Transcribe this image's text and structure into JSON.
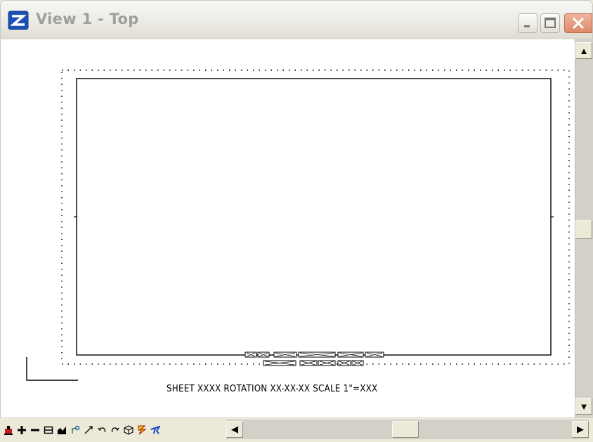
{
  "window": {
    "title": "View 1 - Top",
    "buttons": [
      "minimize",
      "maximize",
      "close"
    ]
  },
  "sheet": {
    "caption": "SHEET XXXX ROTATION XX-XX-XX SCALE 1\"=XXX"
  },
  "view_tools": [
    "update-icon",
    "zoom-in-icon",
    "zoom-out-icon",
    "window-area-icon",
    "fit-view-icon",
    "rotate-view-icon",
    "pan-view-icon",
    "view-previous-icon",
    "view-next-icon",
    "3d-cube-icon",
    "render-icon",
    "walk-icon"
  ],
  "scrollbars": {
    "vertical_position": 0.48,
    "horizontal_position": 0.48
  },
  "colors": {
    "title_text": "#a09f98",
    "close_button": "#dd8a6a",
    "canvas": "#ffffff",
    "chrome": "#ece9d8"
  }
}
